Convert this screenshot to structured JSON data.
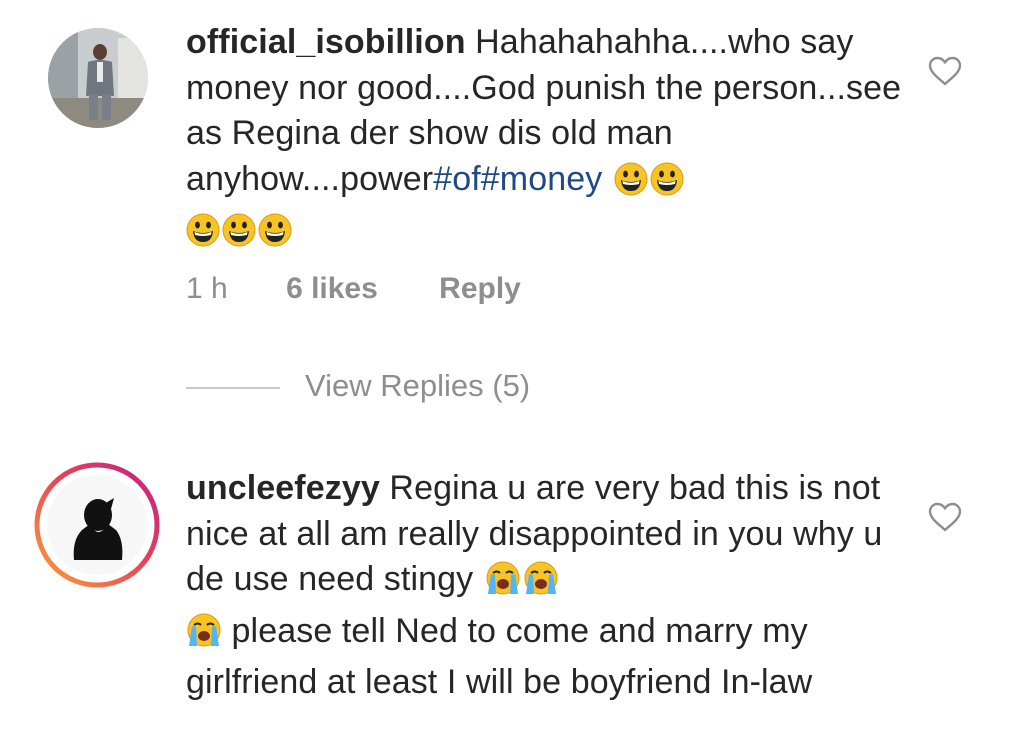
{
  "comments": [
    {
      "username": "official_isobillion",
      "text_part1": " Hahahahahha....who say money nor good....God punish the person...see as Regina der show dis old man anyhow....power",
      "hashtag1": "#of",
      "hashtag2": "#money",
      "emojis": [
        "grinning-face",
        "grinning-face",
        "grinning-face",
        "grinning-face",
        "grinning-face"
      ],
      "time": "1 h",
      "likes": "6 likes",
      "reply": "Reply",
      "view_replies": "View Replies (5)"
    },
    {
      "username": "uncleefezyy",
      "text_part1": " Regina u are very bad this is not nice at all am really disappointed in you why u de use need stingy",
      "text_part2": " please tell Ned to come and marry my girlfriend at least I will be boyfriend In-law",
      "emojis": [
        "loudly-crying-face",
        "loudly-crying-face",
        "loudly-crying-face"
      ]
    }
  ],
  "colors": {
    "text": "#262626",
    "secondary": "#8e8e8e",
    "hashtag": "#1f4a86",
    "story_ring_start": "#f9a13a",
    "story_ring_end": "#c21f85"
  }
}
